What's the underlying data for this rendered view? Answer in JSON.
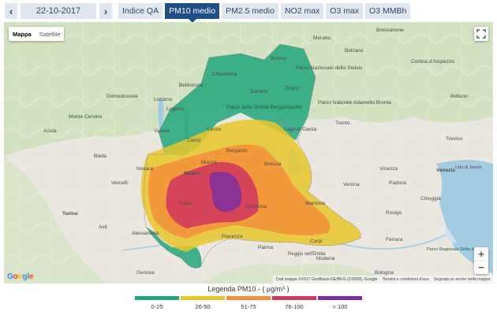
{
  "nav": {
    "prev_icon": "‹",
    "next_icon": "›",
    "date": "22-10-2017"
  },
  "tabs": [
    {
      "label": "Indice QA",
      "active": false
    },
    {
      "label": "PM10 medio",
      "active": true
    },
    {
      "label": "PM2.5 medio",
      "active": false
    },
    {
      "label": "NO2 max",
      "active": false
    },
    {
      "label": "O3 max",
      "active": false
    },
    {
      "label": "O3 MMBh",
      "active": false
    }
  ],
  "map": {
    "type_options": {
      "map": "Mappa",
      "satellite": "Satellite"
    },
    "zoom": {
      "in": "+",
      "out": "−"
    },
    "provider": "Google",
    "attribution": {
      "data": "Dati mappa ©2017 GeoBasis-DE/BKG (©2009), Google",
      "terms": "Termini e condizioni d'uso",
      "report": "Segnala un errore nella mappa"
    },
    "place_labels": [
      "Bressanone",
      "Bolzano",
      "Cortina d'Ampezzo",
      "Parco Nazionale dello Stelvio",
      "Parco Naturale Adamello Brenta",
      "Trento",
      "Parco delle Orobie Bergamasche",
      "Lugano",
      "Locarno",
      "Varese",
      "Como",
      "Lecco",
      "Bergamo",
      "Brescia",
      "Lago di Garda",
      "Monza",
      "Milano",
      "Novara",
      "Biella",
      "Vercelli",
      "Torino",
      "Pavia",
      "Piacenza",
      "Cremona",
      "Mantova",
      "Verona",
      "Vicenza",
      "Padova",
      "Venezia",
      "Chioggia",
      "Rovigo",
      "Ferrara",
      "Modena",
      "Bologna",
      "Parma",
      "Alessandria",
      "Asti",
      "Genova",
      "Monte Cervino",
      "Domodossola",
      "Aosta",
      "Belluno",
      "Treviso",
      "Lido di Jesolo",
      "Carpi",
      "Reggio nell'Emilia",
      "Parco Regionale Delta del Po",
      "Sondrio",
      "Bormio",
      "Chiavenna",
      "Bellinzona",
      "Tirano",
      "Merano"
    ]
  },
  "legend": {
    "title": "Legenda PM10 - ( µg/m³ )",
    "classes": [
      {
        "label": "0-25",
        "color": "#21a67a"
      },
      {
        "label": "26-50",
        "color": "#e8c72c"
      },
      {
        "label": "51-75",
        "color": "#f1923a"
      },
      {
        "label": "76-100",
        "color": "#d2385d"
      },
      {
        "label": "> 100",
        "color": "#7b2f9b"
      }
    ]
  },
  "colors": {
    "tab_bg": "#dfe6ee",
    "tab_active": "#1d4e86",
    "water": "#a3cce3",
    "land": "#e9e7df",
    "mountain": "#c9ddb3"
  }
}
